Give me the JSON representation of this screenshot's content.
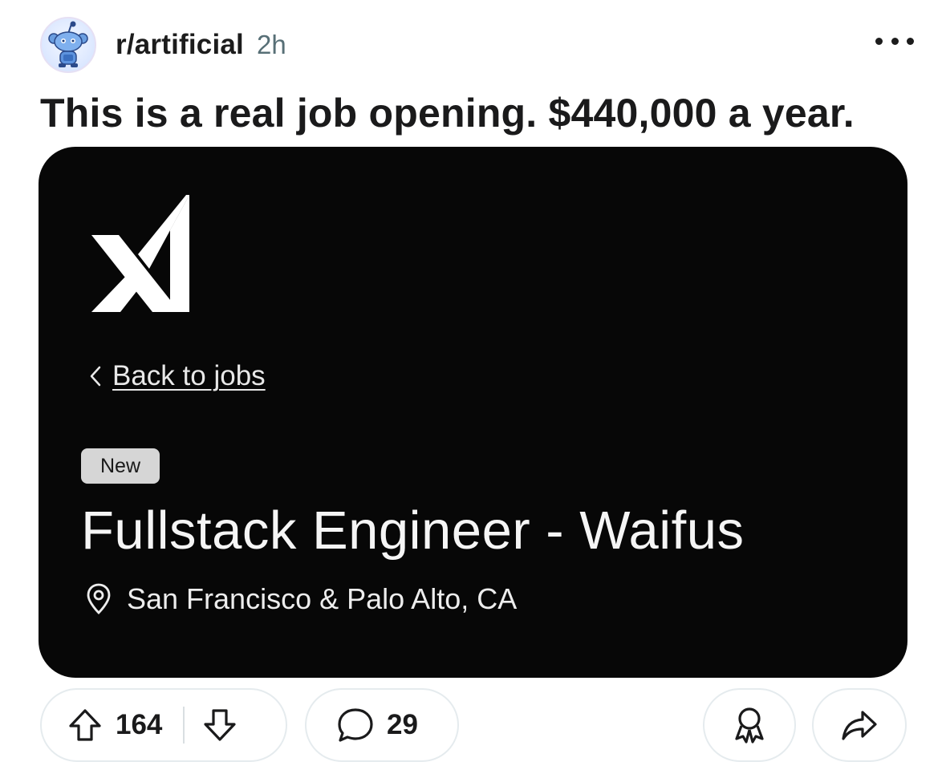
{
  "post": {
    "subreddit": "r/artificial",
    "age": "2h",
    "title": "This is a real job opening. $440,000 a year."
  },
  "image": {
    "back_link": "Back to jobs",
    "badge": "New",
    "job_title": "Fullstack Engineer - Waifus",
    "location": "San Francisco & Palo Alto, CA"
  },
  "actions": {
    "upvotes": "164",
    "comments": "29"
  },
  "icons": {
    "avatar": "reddit-snoo-avatar-icon",
    "more": "more-options-icon",
    "logo": "xai-logo",
    "back": "chevron-left-icon",
    "location": "location-pin-icon",
    "upvote": "upvote-arrow-icon",
    "downvote": "downvote-arrow-icon",
    "comment": "comment-bubble-icon",
    "award": "award-icon",
    "share": "share-arrow-icon"
  },
  "colors": {
    "card_background": "#070707",
    "metadata_gray": "#576f76",
    "text_dark": "#1a1a1b"
  }
}
